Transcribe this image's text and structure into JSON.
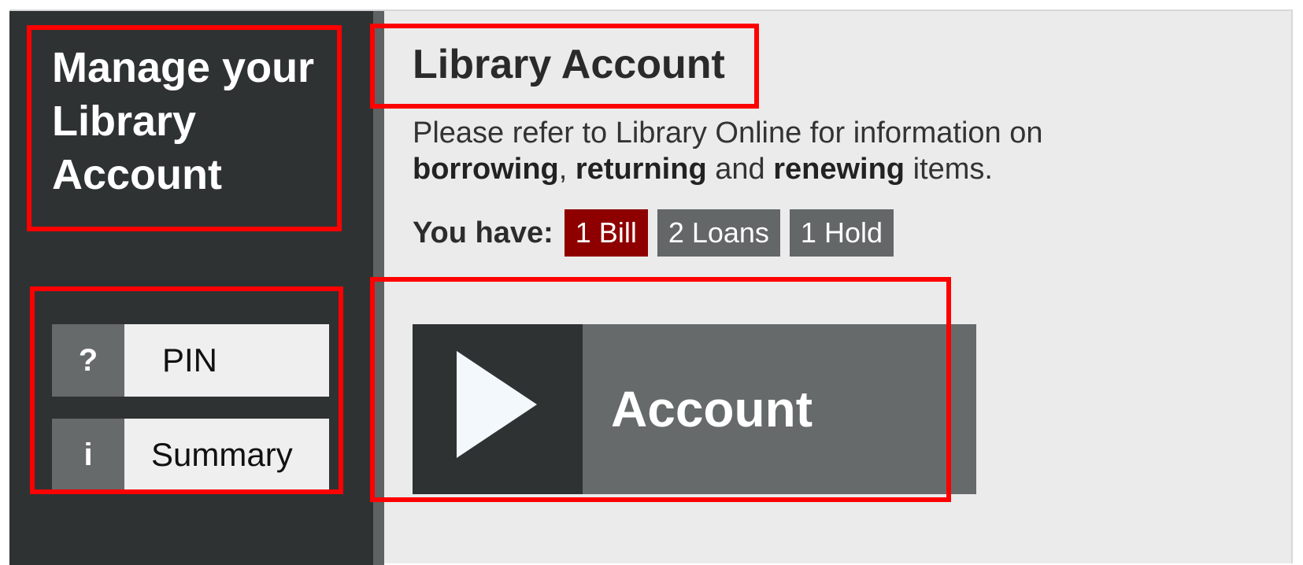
{
  "sidebar": {
    "title": "Manage your Library Account",
    "buttons": [
      {
        "icon": "question-icon",
        "icon_glyph": "?",
        "label": "PIN"
      },
      {
        "icon": "info-icon",
        "icon_glyph": "i",
        "label": "Summary"
      }
    ]
  },
  "main": {
    "title": "Library Account",
    "intro": {
      "prefix": "Please refer to Library Online for information on",
      "borrowing": "borrowing",
      "sep1": ",",
      "returning": "returning",
      "and": "and",
      "renewing": "renewing",
      "suffix": "items."
    },
    "summary": {
      "lead": "You have:",
      "bill": "1 Bill",
      "loans": "2 Loans",
      "holds": "1 Hold"
    },
    "account_button": {
      "icon": "play-icon",
      "label": "Account"
    }
  },
  "colors": {
    "sidebar_bg": "#2f3233",
    "content_bg": "#ebebeb",
    "bill_badge": "#8e0000",
    "grey_badge": "#636767",
    "highlight": "#ff0000"
  }
}
